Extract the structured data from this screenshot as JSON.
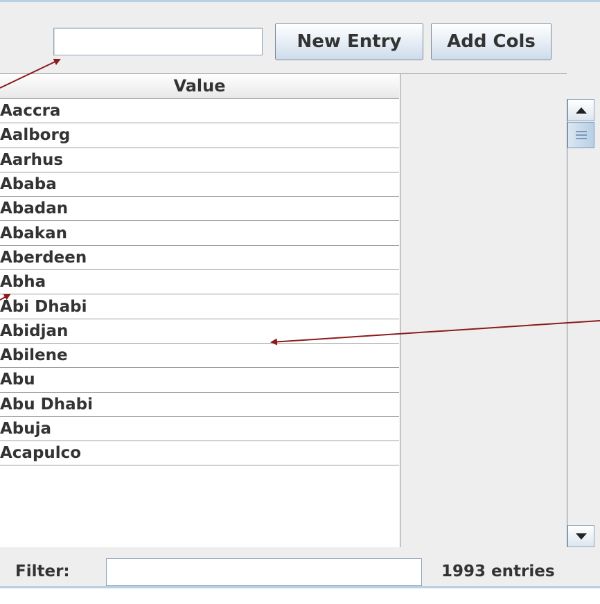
{
  "toolbar": {
    "new_value_input": "",
    "new_entry_label": "New Entry",
    "add_cols_label": "Add Cols"
  },
  "table": {
    "column_header": "Value",
    "rows": [
      "Aaccra",
      "Aalborg",
      "Aarhus",
      "Ababa",
      "Abadan",
      "Abakan",
      "Aberdeen",
      "Abha",
      "Abi Dhabi",
      "Abidjan",
      "Abilene",
      "Abu",
      "Abu Dhabi",
      "Abuja",
      "Acapulco"
    ]
  },
  "footer": {
    "filter_label": "Filter:",
    "filter_value": "",
    "entries_count": "1993 entries"
  },
  "colors": {
    "annotation_arrow": "#8b1a1a",
    "panel_border": "#b8cfe5"
  }
}
